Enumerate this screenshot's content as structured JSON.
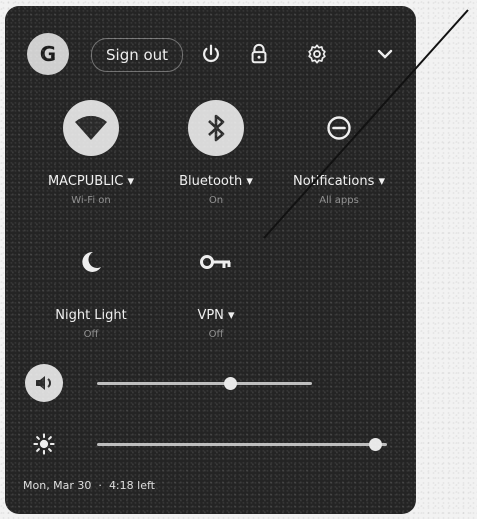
{
  "topbar": {
    "avatar_initial": "G",
    "signout_label": "Sign out",
    "icons": [
      "power-icon",
      "lock-icon",
      "gear-icon",
      "chevron-down-icon"
    ]
  },
  "tiles": [
    {
      "label": "MACPUBLIC ▾",
      "sub": "Wi-Fi on",
      "icon": "wifi-icon",
      "active": true
    },
    {
      "label": "Bluetooth ▾",
      "sub": "On",
      "icon": "bluetooth-icon",
      "active": true
    },
    {
      "label": "Notifications ▾",
      "sub": "All apps",
      "icon": "do-not-disturb-icon",
      "active": false
    },
    {
      "label": "Night Light",
      "sub": "Off",
      "icon": "night-light-icon",
      "active": false
    },
    {
      "label": "VPN ▾",
      "sub": "Off",
      "icon": "vpn-key-icon",
      "active": false
    }
  ],
  "sliders": [
    {
      "icon": "volume-icon",
      "level": 0.62
    },
    {
      "icon": "brightness-icon",
      "level": 0.96
    }
  ],
  "footer": {
    "date": "Mon, Mar 30",
    "battery": "4:18 left"
  },
  "colors": {
    "panel": "#242424",
    "active_tile": "#d9d9d9",
    "text": "#e9e9e9"
  }
}
